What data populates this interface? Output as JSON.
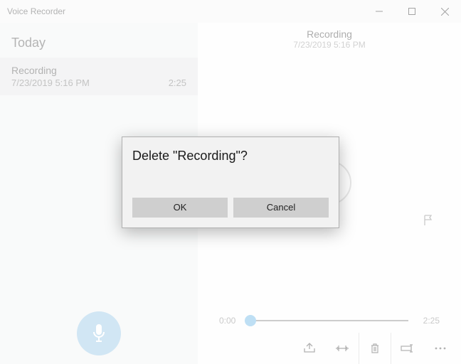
{
  "window": {
    "title": "Voice Recorder"
  },
  "sidebar": {
    "section_label": "Today",
    "items": [
      {
        "name": "Recording",
        "datetime": "7/23/2019 5:16 PM",
        "duration": "2:25"
      }
    ]
  },
  "main": {
    "title": "Recording",
    "subtitle": "7/23/2019 5:16 PM",
    "time_start": "0:00",
    "time_end": "2:25"
  },
  "dialog": {
    "title": "Delete \"Recording\"?",
    "ok_label": "OK",
    "cancel_label": "Cancel"
  }
}
